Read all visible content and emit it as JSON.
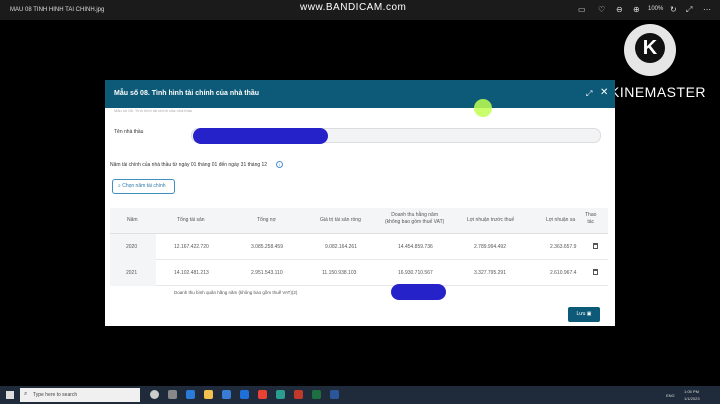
{
  "viewer": {
    "filename": "MAU 08 TINH HINH TAI CHINH.jpg",
    "recorder_watermark": "www.BANDICAM.com",
    "zoom": "100%"
  },
  "watermark": {
    "logo_letter": "K",
    "brand": "KINEMASTER"
  },
  "dialog": {
    "title": "Mẫu số 08. Tình hình tài chính của nhà thầu",
    "subtitle_cut": "Mẫu số 08. Tình hình tài chính của nhà thầu",
    "name_label": "Tên nhà thầu",
    "fiscal_note": "Năm tài chính của nhà thầu từ ngày 01 tháng 01 đến ngày 31 tháng 12",
    "choose_year_button": "Chọn năm tài chính",
    "save_button": "Lưu"
  },
  "table": {
    "headers": {
      "year": "Năm",
      "total_assets": "Tổng tài sản",
      "total_liabilities": "Tổng nợ",
      "net_assets": "Giá trị tài sản ròng",
      "revenue_line1": "Doanh thu hằng năm",
      "revenue_line2": "(không bao gồm thuế VAT)",
      "pretax_profit": "Lợi nhuận trước thuế",
      "aftertax_profit": "Lợi nhuận sa",
      "actions_line1": "Thao",
      "actions_line2": "tác"
    },
    "rows": [
      {
        "year": "2020",
        "total_assets": "12.167.422.720",
        "total_liabilities": "3.085.258.459",
        "net_assets": "9.082.164.261",
        "revenue": "14.454.859.736",
        "pretax_profit": "2.789.994.492",
        "aftertax_profit": "2.363.657.9"
      },
      {
        "year": "2021",
        "total_assets": "14.102.481.213",
        "total_liabilities": "2.951.543.110",
        "net_assets": "11.150.938.103",
        "revenue": "16.930.710.567",
        "pretax_profit": "3.327.795.291",
        "aftertax_profit": "2.610.967.4"
      }
    ],
    "avg_revenue_label": "Doanh thu bình quân hằng năm (không bao gồm thuế VAT)(2)"
  },
  "taskbar": {
    "search_placeholder": "Type here to search",
    "lang": "ENG",
    "time": "1:05 PM",
    "date": "1/1/2023"
  }
}
